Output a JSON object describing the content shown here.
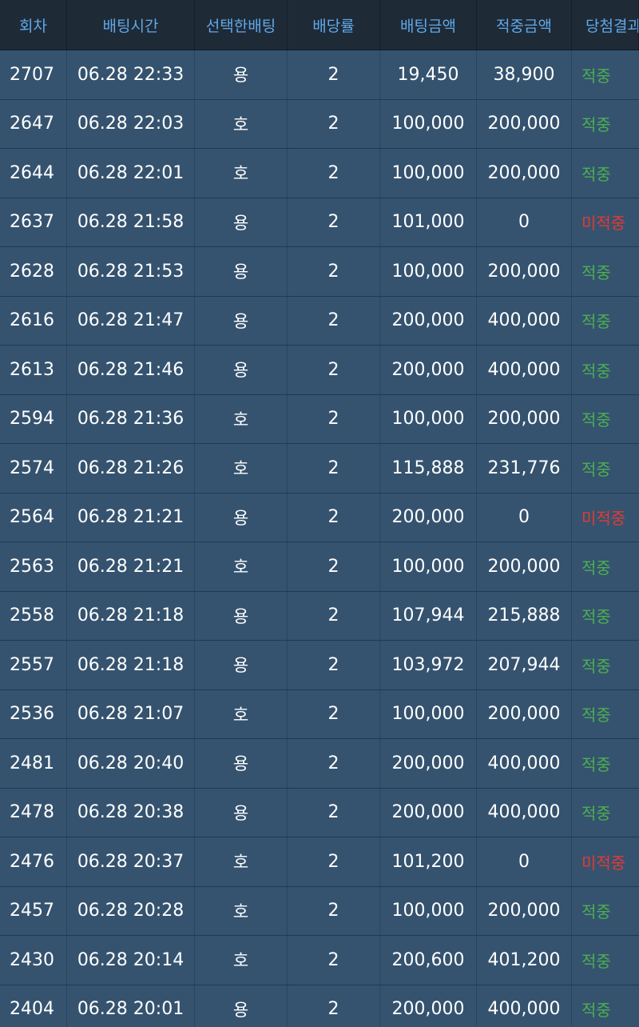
{
  "header": {
    "col_round": "회차",
    "col_time": "배팅시간",
    "col_pick": "선택한배팅",
    "col_odds": "배당률",
    "col_amount": "배팅금액",
    "col_win_amount": "적중금액",
    "col_result": "당첨결과"
  },
  "colors": {
    "hit": "#4caf50",
    "miss": "#e53935",
    "header_text": "#5fa9e8"
  },
  "rows": [
    {
      "round": "2707",
      "time": "06.28 22:33",
      "pick": "용",
      "odds": "2",
      "amount": "19,450",
      "win": "38,900",
      "result": "적중",
      "status": "hit"
    },
    {
      "round": "2647",
      "time": "06.28 22:03",
      "pick": "호",
      "odds": "2",
      "amount": "100,000",
      "win": "200,000",
      "result": "적중",
      "status": "hit"
    },
    {
      "round": "2644",
      "time": "06.28 22:01",
      "pick": "호",
      "odds": "2",
      "amount": "100,000",
      "win": "200,000",
      "result": "적중",
      "status": "hit"
    },
    {
      "round": "2637",
      "time": "06.28 21:58",
      "pick": "용",
      "odds": "2",
      "amount": "101,000",
      "win": "0",
      "result": "미적중",
      "status": "miss"
    },
    {
      "round": "2628",
      "time": "06.28 21:53",
      "pick": "용",
      "odds": "2",
      "amount": "100,000",
      "win": "200,000",
      "result": "적중",
      "status": "hit"
    },
    {
      "round": "2616",
      "time": "06.28 21:47",
      "pick": "용",
      "odds": "2",
      "amount": "200,000",
      "win": "400,000",
      "result": "적중",
      "status": "hit"
    },
    {
      "round": "2613",
      "time": "06.28 21:46",
      "pick": "용",
      "odds": "2",
      "amount": "200,000",
      "win": "400,000",
      "result": "적중",
      "status": "hit"
    },
    {
      "round": "2594",
      "time": "06.28 21:36",
      "pick": "호",
      "odds": "2",
      "amount": "100,000",
      "win": "200,000",
      "result": "적중",
      "status": "hit"
    },
    {
      "round": "2574",
      "time": "06.28 21:26",
      "pick": "호",
      "odds": "2",
      "amount": "115,888",
      "win": "231,776",
      "result": "적중",
      "status": "hit"
    },
    {
      "round": "2564",
      "time": "06.28 21:21",
      "pick": "용",
      "odds": "2",
      "amount": "200,000",
      "win": "0",
      "result": "미적중",
      "status": "miss"
    },
    {
      "round": "2563",
      "time": "06.28 21:21",
      "pick": "호",
      "odds": "2",
      "amount": "100,000",
      "win": "200,000",
      "result": "적중",
      "status": "hit"
    },
    {
      "round": "2558",
      "time": "06.28 21:18",
      "pick": "용",
      "odds": "2",
      "amount": "107,944",
      "win": "215,888",
      "result": "적중",
      "status": "hit"
    },
    {
      "round": "2557",
      "time": "06.28 21:18",
      "pick": "용",
      "odds": "2",
      "amount": "103,972",
      "win": "207,944",
      "result": "적중",
      "status": "hit"
    },
    {
      "round": "2536",
      "time": "06.28 21:07",
      "pick": "호",
      "odds": "2",
      "amount": "100,000",
      "win": "200,000",
      "result": "적중",
      "status": "hit"
    },
    {
      "round": "2481",
      "time": "06.28 20:40",
      "pick": "용",
      "odds": "2",
      "amount": "200,000",
      "win": "400,000",
      "result": "적중",
      "status": "hit"
    },
    {
      "round": "2478",
      "time": "06.28 20:38",
      "pick": "용",
      "odds": "2",
      "amount": "200,000",
      "win": "400,000",
      "result": "적중",
      "status": "hit"
    },
    {
      "round": "2476",
      "time": "06.28 20:37",
      "pick": "호",
      "odds": "2",
      "amount": "101,200",
      "win": "0",
      "result": "미적중",
      "status": "miss"
    },
    {
      "round": "2457",
      "time": "06.28 20:28",
      "pick": "호",
      "odds": "2",
      "amount": "100,000",
      "win": "200,000",
      "result": "적중",
      "status": "hit"
    },
    {
      "round": "2430",
      "time": "06.28 20:14",
      "pick": "호",
      "odds": "2",
      "amount": "200,600",
      "win": "401,200",
      "result": "적중",
      "status": "hit"
    },
    {
      "round": "2404",
      "time": "06.28 20:01",
      "pick": "용",
      "odds": "2",
      "amount": "200,000",
      "win": "400,000",
      "result": "적중",
      "status": "hit"
    }
  ]
}
